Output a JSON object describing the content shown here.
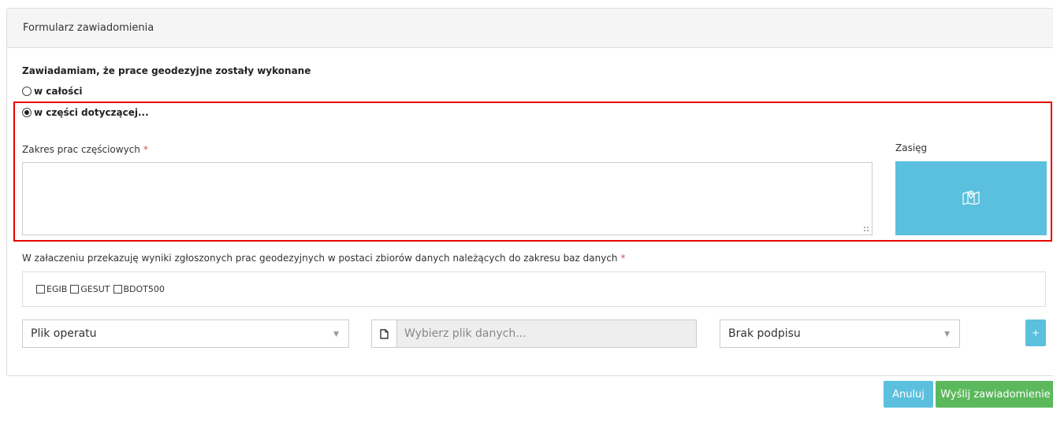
{
  "panel": {
    "title": "Formularz zawiadomienia"
  },
  "form": {
    "question": "Zawiadamiam, że prace geodezyjne zostały wykonane",
    "options": [
      {
        "label": "w całości",
        "selected": false
      },
      {
        "label": "w części dotyczącej...",
        "selected": true
      }
    ],
    "partial_scope_label": "Zakres prac częściowych",
    "partial_scope_value": "",
    "required_mark": "*",
    "range_label": "Zasięg",
    "range_button_icon": "map-pin-icon",
    "attachment_label": "W załaczeniu przekazuję wyniki zgłoszonych prac geodezyjnych w postaci zbiorów danych należących do zakresu baz danych",
    "databases": [
      {
        "label": "EGIB",
        "checked": false
      },
      {
        "label": "GESUT",
        "checked": false
      },
      {
        "label": "BDOT500",
        "checked": false
      }
    ],
    "file_type_select": "Plik operatu",
    "file_placeholder": "Wybierz plik danych...",
    "signature_select": "Brak podpisu",
    "add_button": "+"
  },
  "actions": {
    "cancel": "Anuluj",
    "send": "Wyślij zawiadomienie"
  },
  "colors": {
    "info": "#5bc0de",
    "success": "#5cb85c",
    "required": "#d9534f",
    "highlight": "#e60000"
  }
}
